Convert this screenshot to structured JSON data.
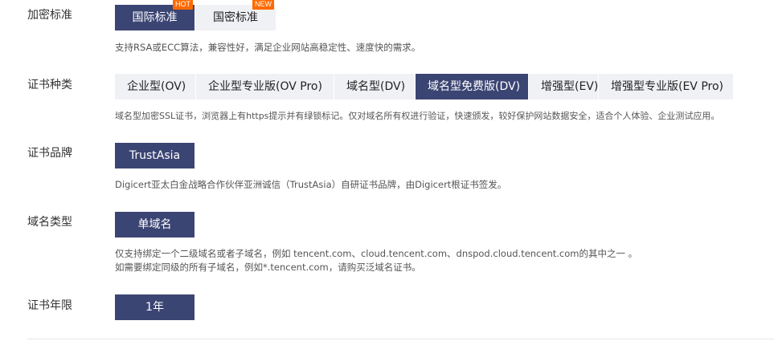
{
  "encryption": {
    "label": "加密标准",
    "options": [
      {
        "text": "国际标准",
        "badge": "HOT",
        "selected": true
      },
      {
        "text": "国密标准",
        "badge": "NEW",
        "selected": false
      }
    ],
    "desc": "支持RSA或ECC算法，兼容性好，满足企业网站高稳定性、速度快的需求。"
  },
  "cert_type": {
    "label": "证书种类",
    "options": [
      {
        "text": "企业型(OV)",
        "selected": false
      },
      {
        "text": "企业型专业版(OV Pro)",
        "selected": false
      },
      {
        "text": "域名型(DV)",
        "selected": false
      },
      {
        "text": "域名型免费版(DV)",
        "selected": true
      },
      {
        "text": "增强型(EV)",
        "selected": false
      },
      {
        "text": "增强型专业版(EV Pro)",
        "selected": false
      }
    ],
    "desc": "域名型加密SSL证书，浏览器上有https提示并有绿锁标记。仅对域名所有权进行验证，快速颁发，较好保护网站数据安全，适合个人体验、企业测试应用。"
  },
  "brand": {
    "label": "证书品牌",
    "options": [
      {
        "text": "TrustAsia",
        "selected": true
      }
    ],
    "desc": "Digicert亚太白金战略合作伙伴亚洲诚信（TrustAsia）自研证书品牌，由Digicert根证书签发。"
  },
  "domain_type": {
    "label": "域名类型",
    "options": [
      {
        "text": "单域名",
        "selected": true
      }
    ],
    "desc1": "仅支持绑定一个二级域名或者子域名，例如 tencent.com、cloud.tencent.com、dnspod.cloud.tencent.com的其中之一 。",
    "desc2": "如需要绑定同级的所有子域名，例如*.tencent.com，请购买泛域名证书。"
  },
  "years": {
    "label": "证书年限",
    "options": [
      {
        "text": "1年",
        "selected": true
      }
    ]
  },
  "colors": {
    "selected_bg": "#3b4573",
    "unselected_bg": "#f0f1f5",
    "badge": "#ff6a00"
  }
}
